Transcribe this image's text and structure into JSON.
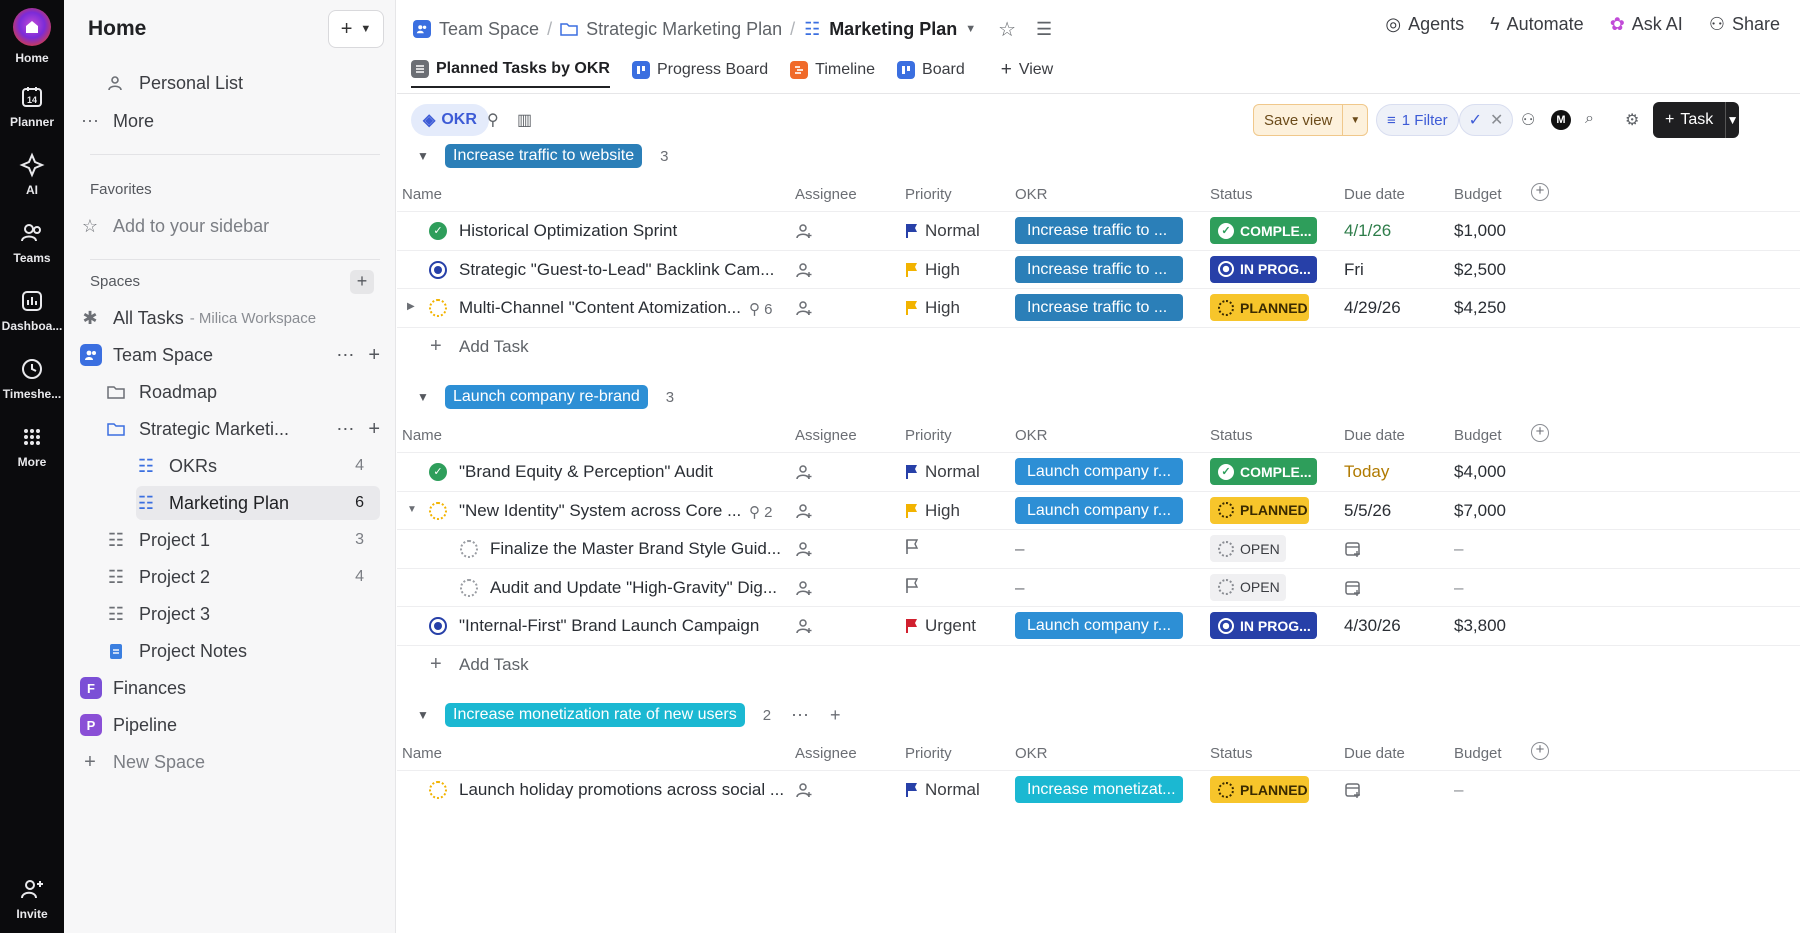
{
  "rail": [
    {
      "label": "Home",
      "icon": "home-logo-icon"
    },
    {
      "label": "Planner",
      "icon": "calendar-icon",
      "day": "14"
    },
    {
      "label": "AI",
      "icon": "ai-icon"
    },
    {
      "label": "Teams",
      "icon": "teams-icon"
    },
    {
      "label": "Dashboa...",
      "icon": "dashboard-icon"
    },
    {
      "label": "Timeshe...",
      "icon": "clock-icon"
    },
    {
      "label": "More",
      "icon": "grid-icon"
    },
    {
      "label": "Invite",
      "icon": "invite-icon"
    }
  ],
  "sidebar": {
    "title": "Home",
    "personal_list": "Personal List",
    "more": "More",
    "favorites_title": "Favorites",
    "add_to_sidebar": "Add to your sidebar",
    "spaces_title": "Spaces",
    "all_tasks": "All Tasks",
    "all_tasks_sub": "- Milica Workspace",
    "team_space": "Team Space",
    "roadmap": "Roadmap",
    "strategic": "Strategic Marketi...",
    "okrs": "OKRs",
    "okrs_count": "4",
    "marketing_plan": "Marketing Plan",
    "marketing_plan_count": "6",
    "project1": "Project 1",
    "project1_count": "3",
    "project2": "Project 2",
    "project2_count": "4",
    "project3": "Project 3",
    "project_notes": "Project Notes",
    "finances": "Finances",
    "finances_badge": "F",
    "pipeline": "Pipeline",
    "pipeline_badge": "P",
    "new_space": "New Space"
  },
  "breadcrumb": {
    "team_space": "Team Space",
    "strategic": "Strategic Marketing Plan",
    "current": "Marketing Plan"
  },
  "top_actions": {
    "agents": "Agents",
    "automate": "Automate",
    "ask_ai": "Ask AI",
    "share": "Share"
  },
  "tabs": [
    {
      "label": "Planned Tasks by OKR",
      "active": true
    },
    {
      "label": "Progress Board"
    },
    {
      "label": "Timeline"
    },
    {
      "label": "Board"
    },
    {
      "label": "View"
    }
  ],
  "toolbar": {
    "okr": "OKR",
    "save_view": "Save view",
    "filter": "1 Filter",
    "avatar": "M",
    "task": "Task"
  },
  "columns": {
    "name": "Name",
    "assignee": "Assignee",
    "priority": "Priority",
    "okr": "OKR",
    "status": "Status",
    "due": "Due date",
    "budget": "Budget"
  },
  "add_task": "Add Task",
  "groups": [
    {
      "title": "Increase traffic to website",
      "count": "3",
      "color": "#2b7fb8",
      "rows": [
        {
          "name": "Historical Optimization Sprint",
          "status_dot": "complete",
          "priority": "Normal",
          "flag": "#2740a8",
          "okr": "Increase traffic to ...",
          "status": "COMPLE...",
          "status_kind": "complete",
          "due": "4/1/26",
          "due_color": "#2e7d4a",
          "budget": "$1,000"
        },
        {
          "name": "Strategic \"Guest-to-Lead\" Backlink Cam...",
          "status_dot": "prog",
          "priority": "High",
          "flag": "#f2b300",
          "okr": "Increase traffic to ...",
          "status": "IN PROG...",
          "status_kind": "prog",
          "due": "Fri",
          "due_color": "#2a2e34",
          "budget": "$2,500"
        },
        {
          "name": "Multi-Channel \"Content Atomization...",
          "status_dot": "planned",
          "subcount": "6",
          "expander": "▶",
          "priority": "High",
          "flag": "#f2b300",
          "okr": "Increase traffic to ...",
          "status": "PLANNED",
          "status_kind": "planned",
          "due": "4/29/26",
          "due_color": "#2a2e34",
          "budget": "$4,250"
        }
      ]
    },
    {
      "title": "Launch company re-brand",
      "count": "3",
      "color": "#2d8fd5",
      "rows": [
        {
          "name": "\"Brand Equity & Perception\" Audit",
          "status_dot": "complete",
          "priority": "Normal",
          "flag": "#2740a8",
          "okr": "Launch company r...",
          "status": "COMPLE...",
          "status_kind": "complete",
          "due": "Today",
          "due_color": "#b07a00",
          "budget": "$4,000"
        },
        {
          "name": "\"New Identity\" System across Core ...",
          "status_dot": "planned",
          "subcount": "2",
          "expander": "▼",
          "priority": "High",
          "flag": "#f2b300",
          "okr": "Launch company r...",
          "status": "PLANNED",
          "status_kind": "planned",
          "due": "5/5/26",
          "due_color": "#2a2e34",
          "budget": "$7,000"
        },
        {
          "name": "Finalize the Master Brand Style Guid...",
          "status_dot": "open",
          "indent": true,
          "priority": "",
          "flag": "",
          "okr": "–",
          "status": "OPEN",
          "status_kind": "open",
          "due": "",
          "due_color": "#2a2e34",
          "budget": "–"
        },
        {
          "name": "Audit and Update \"High-Gravity\" Dig...",
          "status_dot": "open",
          "indent": true,
          "priority": "",
          "flag": "",
          "okr": "–",
          "status": "OPEN",
          "status_kind": "open",
          "due": "",
          "due_color": "#2a2e34",
          "budget": "–"
        },
        {
          "name": "\"Internal-First\" Brand Launch Campaign",
          "status_dot": "prog",
          "priority": "Urgent",
          "flag": "#d1202f",
          "okr": "Launch company r...",
          "status": "IN PROG...",
          "status_kind": "prog",
          "due": "4/30/26",
          "due_color": "#2a2e34",
          "budget": "$3,800"
        }
      ]
    },
    {
      "title": "Increase monetization rate of new users",
      "count": "2",
      "color": "#1bb8d2",
      "rows": [
        {
          "name": "Launch holiday promotions across social ...",
          "status_dot": "planned",
          "priority": "Normal",
          "flag": "#2740a8",
          "okr": "Increase monetizat...",
          "status": "PLANNED",
          "status_kind": "planned",
          "due": "",
          "due_color": "#2a2e34",
          "budget": "–"
        }
      ]
    }
  ]
}
